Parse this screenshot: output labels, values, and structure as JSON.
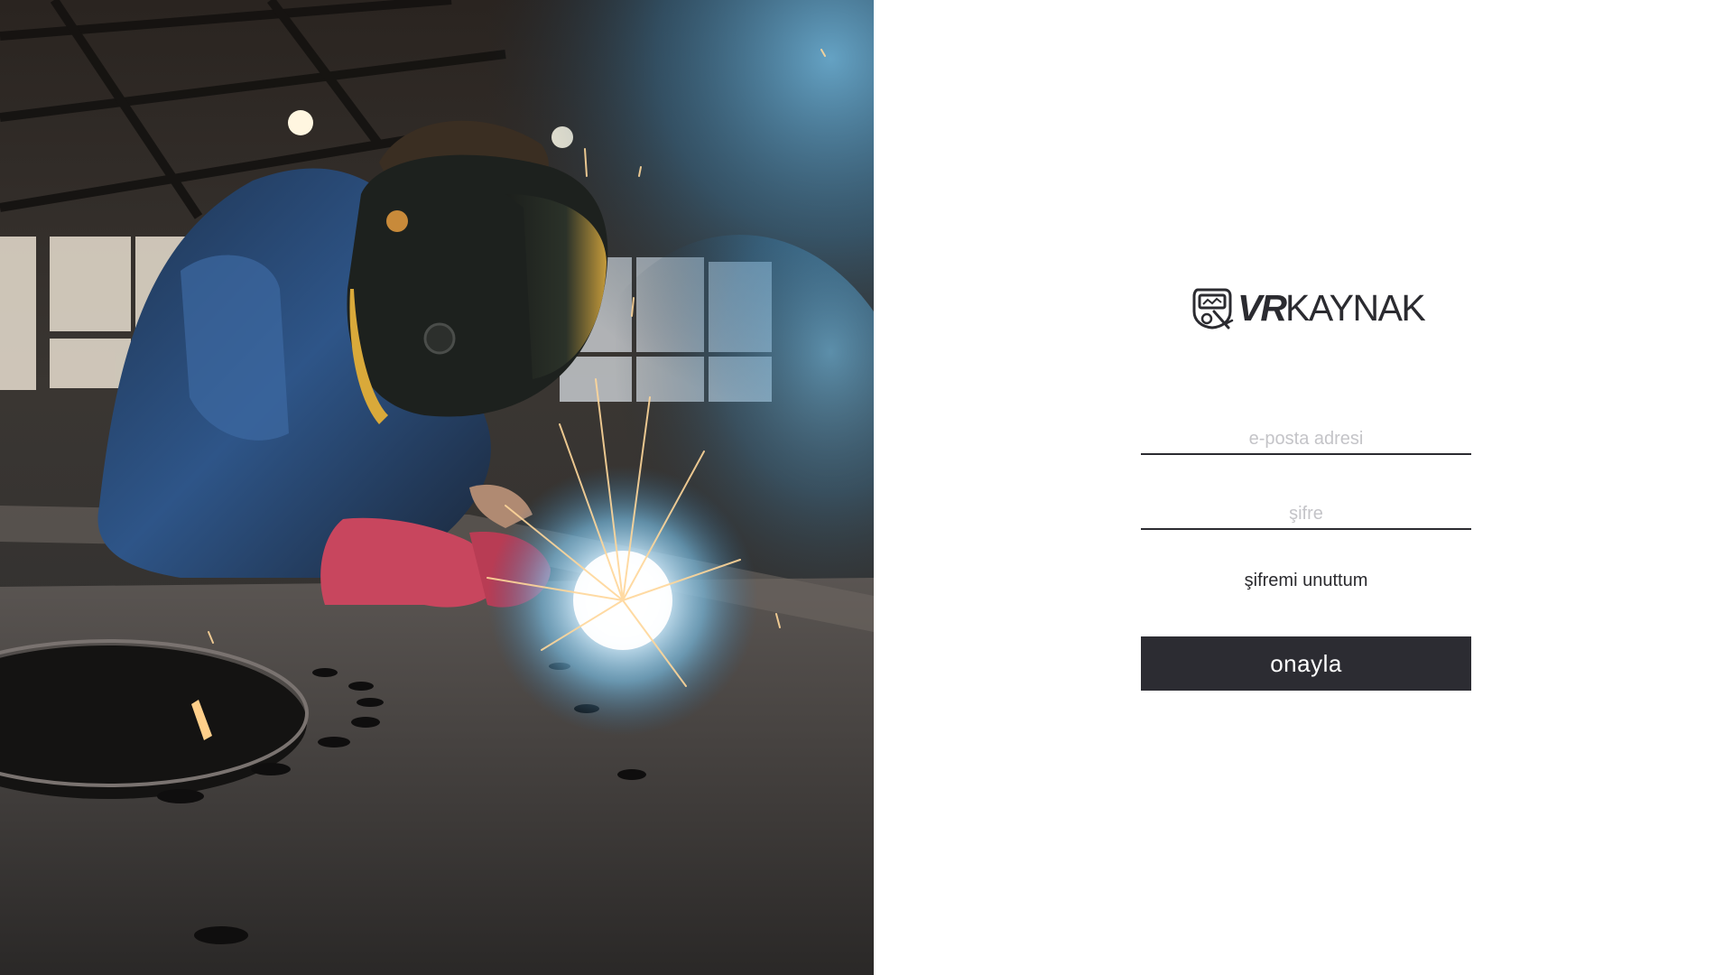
{
  "hero": {
    "image_description": "welder-photo"
  },
  "brand": {
    "logo_bold": "VR",
    "logo_light": "KAYNAK",
    "icon": "welding-helmet-icon"
  },
  "login": {
    "email_placeholder": "e-posta adresi",
    "password_placeholder": "şifre",
    "forgot_label": "şifremi unuttum",
    "submit_label": "onayla"
  },
  "colors": {
    "primary": "#2c2c32",
    "placeholder": "#c4c4c8",
    "background": "#ffffff"
  }
}
